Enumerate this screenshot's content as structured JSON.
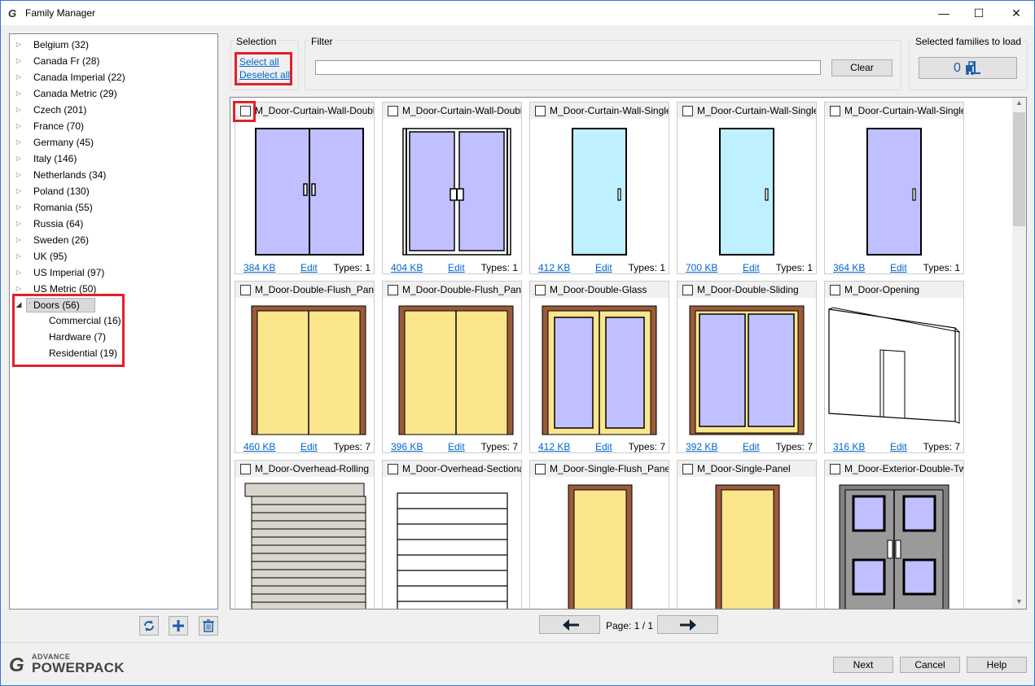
{
  "window": {
    "title": "Family Manager",
    "minimize": "—",
    "maximize": "☐",
    "close": "✕"
  },
  "tree": {
    "items": [
      {
        "label": "Belgium (32)"
      },
      {
        "label": "Canada Fr (28)"
      },
      {
        "label": "Canada Imperial (22)"
      },
      {
        "label": "Canada Metric (29)"
      },
      {
        "label": "Czech (201)"
      },
      {
        "label": "France (70)"
      },
      {
        "label": "Germany (45)"
      },
      {
        "label": "Italy (146)"
      },
      {
        "label": "Netherlands (34)"
      },
      {
        "label": "Poland (130)"
      },
      {
        "label": "Romania (55)"
      },
      {
        "label": "Russia (64)"
      },
      {
        "label": "Sweden (26)"
      },
      {
        "label": "UK (95)"
      },
      {
        "label": "US Imperial (97)"
      },
      {
        "label": "US Metric (50)"
      }
    ],
    "selected": {
      "label": "Doors (56)"
    },
    "children": [
      {
        "label": "Commercial (16)"
      },
      {
        "label": "Hardware (7)"
      },
      {
        "label": "Residential (19)"
      }
    ]
  },
  "selection": {
    "label": "Selection",
    "select_all": "Select all",
    "deselect_all": "Deselect all"
  },
  "filter": {
    "label": "Filter",
    "value": "",
    "clear": "Clear"
  },
  "selected_families": {
    "label": "Selected families to load",
    "count": "0"
  },
  "cards": [
    {
      "name": "M_Door-Curtain-Wall-Double",
      "size": "384 KB",
      "edit": "Edit",
      "types": "Types: 1",
      "img": "cw-double-glass"
    },
    {
      "name": "M_Door-Curtain-Wall-Double",
      "size": "404 KB",
      "edit": "Edit",
      "types": "Types: 1",
      "img": "cw-double-frame"
    },
    {
      "name": "M_Door-Curtain-Wall-Single",
      "size": "412 KB",
      "edit": "Edit",
      "types": "Types: 1",
      "img": "cw-single-cyan"
    },
    {
      "name": "M_Door-Curtain-Wall-Single",
      "size": "700 KB",
      "edit": "Edit",
      "types": "Types: 1",
      "img": "cw-single-cyan2"
    },
    {
      "name": "M_Door-Curtain-Wall-Single",
      "size": "364 KB",
      "edit": "Edit",
      "types": "Types: 1",
      "img": "cw-single-violet"
    },
    {
      "name": "M_Door-Double-Flush_Panel",
      "size": "460 KB",
      "edit": "Edit",
      "types": "Types: 7",
      "img": "double-flush"
    },
    {
      "name": "M_Door-Double-Flush_Panel",
      "size": "396 KB",
      "edit": "Edit",
      "types": "Types: 7",
      "img": "double-flush"
    },
    {
      "name": "M_Door-Double-Glass",
      "size": "412 KB",
      "edit": "Edit",
      "types": "Types: 7",
      "img": "double-glass"
    },
    {
      "name": "M_Door-Double-Sliding",
      "size": "392 KB",
      "edit": "Edit",
      "types": "Types: 7",
      "img": "double-sliding"
    },
    {
      "name": "M_Door-Opening",
      "size": "316 KB",
      "edit": "Edit",
      "types": "Types: 7",
      "img": "opening"
    },
    {
      "name": "M_Door-Overhead-Rolling",
      "size": "",
      "edit": "",
      "types": "",
      "img": "rolling"
    },
    {
      "name": "M_Door-Overhead-Sectional",
      "size": "",
      "edit": "",
      "types": "",
      "img": "sectional"
    },
    {
      "name": "M_Door-Single-Flush_Panel_",
      "size": "",
      "edit": "",
      "types": "",
      "img": "single-flush"
    },
    {
      "name": "M_Door-Single-Panel",
      "size": "",
      "edit": "",
      "types": "",
      "img": "single-flush"
    },
    {
      "name": "M_Door-Exterior-Double-Tw",
      "size": "",
      "edit": "",
      "types": "",
      "img": "exterior-double"
    }
  ],
  "pager": {
    "label": "Page: 1 / 1"
  },
  "footer": {
    "brand_top": "ADVANCE",
    "brand_main": "POWERPACK",
    "next": "Next",
    "cancel": "Cancel",
    "help": "Help"
  }
}
